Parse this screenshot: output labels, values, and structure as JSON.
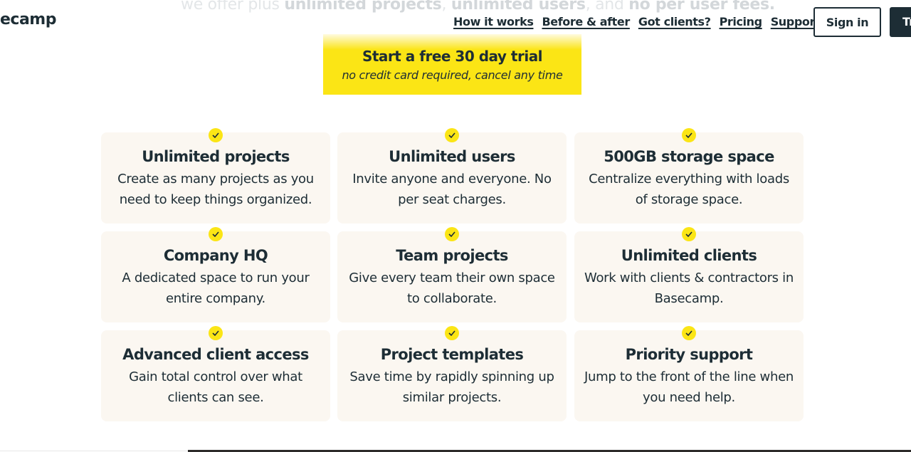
{
  "intro": {
    "prefix": "we offer plus ",
    "b1": "unlimited projects",
    "mid1": ", ",
    "b2": "unlimited users",
    "mid2": ", and ",
    "b3": "no per user fees."
  },
  "header": {
    "logo": "ecamp",
    "nav": [
      "How it works",
      "Before & after",
      "Got clients?",
      "Pricing",
      "Support"
    ],
    "sign_in": "Sign in",
    "try_label": "Try"
  },
  "cta": {
    "title": "Start a free 30 day trial",
    "subtitle": "no credit card required, cancel any time"
  },
  "features": [
    {
      "title": "Unlimited projects",
      "desc": "Create as many projects as you need to keep things organized."
    },
    {
      "title": "Unlimited users",
      "desc": "Invite anyone and everyone. No per seat charges."
    },
    {
      "title": "500GB storage space",
      "desc": "Centralize everything with loads of storage space."
    },
    {
      "title": "Company HQ",
      "desc": "A dedicated space to run your entire company."
    },
    {
      "title": "Team projects",
      "desc": "Give every team their own space to collaborate."
    },
    {
      "title": "Unlimited clients",
      "desc": "Work with clients & contractors in Basecamp."
    },
    {
      "title": "Advanced client access",
      "desc": "Gain total control over what clients can see."
    },
    {
      "title": "Project templates",
      "desc": "Save time by rapidly spinning up similar projects."
    },
    {
      "title": "Priority support",
      "desc": "Jump to the front of the line when you need help."
    }
  ],
  "colors": {
    "accent": "#fbe515",
    "ink": "#1d2d35",
    "card": "#fbf7f1"
  }
}
